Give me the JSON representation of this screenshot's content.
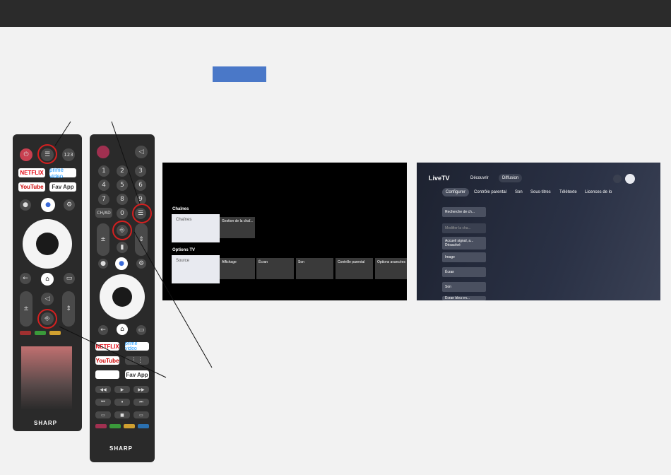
{
  "remote1": {
    "brand": "SHARP",
    "top_buttons": [
      "⏻",
      "☰",
      "123"
    ],
    "apps": [
      "NETFLIX",
      "prime video",
      "YouTube",
      "Fav App"
    ]
  },
  "remote2": {
    "brand": "SHARP",
    "digits": [
      "1",
      "2",
      "3",
      "4",
      "5",
      "6",
      "7",
      "8",
      "9",
      "0"
    ],
    "other": "CH/AD",
    "apps": [
      "NETFLIX",
      "prime video",
      "YouTube",
      "",
      "Fav App"
    ]
  },
  "screen1": {
    "section1": "Chaînes",
    "card1": "Chaînes",
    "card2": "Gestion de la chaî...",
    "section2": "Options TV",
    "source": "Source",
    "cards": [
      "Affichage",
      "Écran",
      "Son",
      "Contrôle parental",
      "Options avancées"
    ]
  },
  "screen2": {
    "logo": "LiveTV",
    "nav": [
      "Découvrir",
      "Diffusion"
    ],
    "tabs": [
      "Configurer",
      "Contrôle parental",
      "Son",
      "Sous-titres",
      "Télétexte",
      "Licences de lo"
    ],
    "menu": [
      "Recherche de ch...",
      "Modifier la cha...",
      "Accueil signal, a... Désactivé",
      "Image",
      "Écran",
      "Son",
      "Écran bleu en..."
    ]
  },
  "colors": {
    "ring": "#d42020",
    "blue_button": "#4a78c8"
  }
}
